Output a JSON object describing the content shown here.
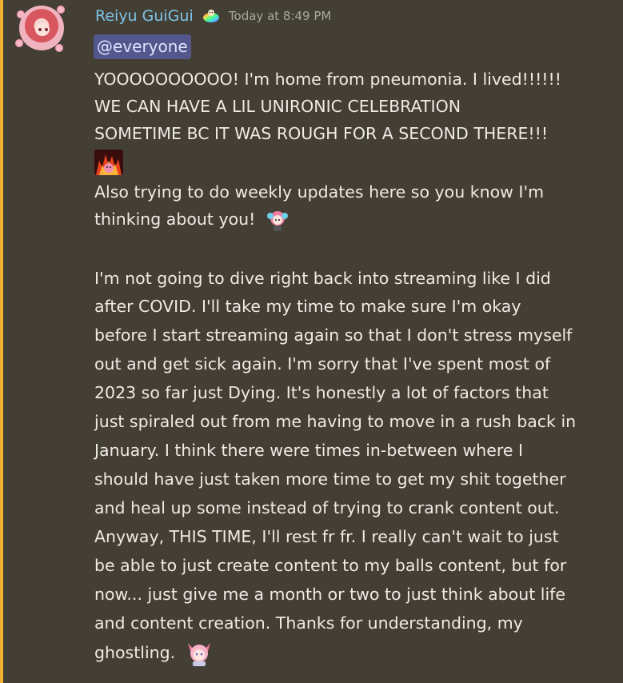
{
  "message": {
    "author": "Reiyu GuiGui",
    "timestamp": "Today at 8:49 PM",
    "mention": "@everyone",
    "lines": [
      "YOOOOOOOOOO! I'm home from pneumonia. I lived!!!!!!",
      "WE CAN HAVE A LIL UNIRONIC CELEBRATION",
      "SOMETIME BC IT WAS ROUGH FOR A SECOND THERE!!!",
      "Also trying to do weekly updates here so you know I'm",
      "thinking about you!",
      "I'm not going to dive right back into streaming like I did",
      "after COVID. I'll take my time to make sure I'm okay",
      "before I start streaming again so that I don't stress myself",
      "out and get sick again.  I'm sorry that I've spent most of",
      "2023 so far just Dying. It's honestly a lot of factors that",
      "just spiraled out from me having to move in a rush back in",
      "January. I think there were times in-between where I",
      "should have just taken more time to get my shit together",
      "and heal up some instead of trying to crank content out.",
      "Anyway, THIS TIME, I'll rest fr fr. I really can't wait to just",
      "be able to just create content to my balls content, but for",
      "now... just give me a month or two to just think about life",
      "and content creation. Thanks for understanding, my",
      "ghostling."
    ],
    "emojis": {
      "role_badge": "rainbow-badge-icon",
      "after_line_3": "fire-anime-emoji",
      "after_line_5": "anime-girl-emoji",
      "after_line_19": "anime-girl-emoji"
    }
  },
  "colors": {
    "background": "#443f35",
    "accent_bar": "#f0b232",
    "username": "#7ec3e6",
    "timestamp": "#a7a7a0",
    "text": "#efeae4",
    "mention_bg": "#54578c",
    "mention_text": "#dfe3ff"
  }
}
